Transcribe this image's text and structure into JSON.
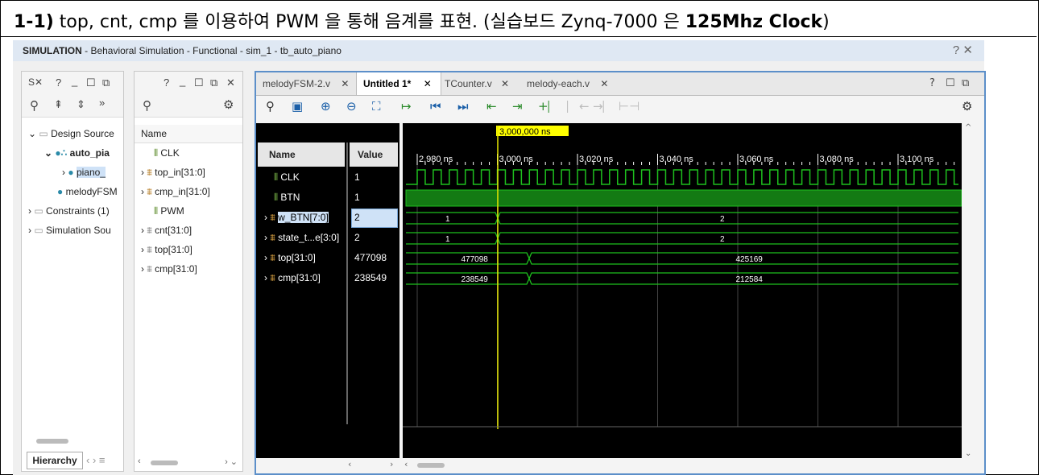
{
  "heading": {
    "prefix": "1-1)",
    "text": " top, cnt, cmp 를 이용하여 PWM 을 통해 음계를 표현. (실습보드 Zynq-7000 은 ",
    "bold_tail": "125Mhz Clock",
    "suffix": ")"
  },
  "sim_header": {
    "bold": "SIMULATION",
    "rest": " - Behavioral Simulation - Functional - sim_1 - tb_auto_piano",
    "controls": "? ✕"
  },
  "sources_panel": {
    "tab": "S",
    "tree": [
      {
        "label": "Design Source",
        "indent": 0
      },
      {
        "label": "auto_pia",
        "indent": 1
      },
      {
        "label": "piano_",
        "indent": 2
      },
      {
        "label": "melodyFSM",
        "indent": 1
      },
      {
        "label": "Constraints (1)",
        "indent": 0
      },
      {
        "label": "Simulation Sou",
        "indent": 0
      }
    ],
    "bottom_tab": "Hierarchy"
  },
  "objects_panel": {
    "header": "Name",
    "items": [
      "CLK",
      "top_in[31:0]",
      "cmp_in[31:0]",
      "PWM",
      "cnt[31:0]",
      "top[31:0]",
      "cmp[31:0]"
    ]
  },
  "tabs": [
    {
      "label": "melodyFSM-2.v",
      "active": false
    },
    {
      "label": "Untitled 1*",
      "active": true
    },
    {
      "label": "TCounter.v",
      "active": false
    },
    {
      "label": "melody-each.v",
      "active": false
    }
  ],
  "wave": {
    "col_name": "Name",
    "col_value": "Value",
    "cursor_label": "3,000,000 ns",
    "signals": [
      {
        "name": "CLK",
        "value": "1",
        "kind": "bit"
      },
      {
        "name": "BTN",
        "value": "1",
        "kind": "bit"
      },
      {
        "name": "w_BTN[7:0]",
        "value": "2",
        "kind": "bus"
      },
      {
        "name": "state_t...e[3:0]",
        "value": "2",
        "kind": "bus"
      },
      {
        "name": "top[31:0]",
        "value": "477098",
        "kind": "bus"
      },
      {
        "name": "cmp[31:0]",
        "value": "238549",
        "kind": "bus"
      }
    ],
    "ticks": [
      "2,980 ns",
      "3,000 ns",
      "3,020 ns",
      "3,040 ns",
      "3,060 ns",
      "3,080 ns",
      "3,100 ns"
    ],
    "bus_values": {
      "w_btn": [
        "1",
        "2"
      ],
      "state": [
        "1",
        "2"
      ],
      "top": [
        "477098",
        "425169"
      ],
      "cmp": [
        "238549",
        "212584"
      ]
    }
  }
}
